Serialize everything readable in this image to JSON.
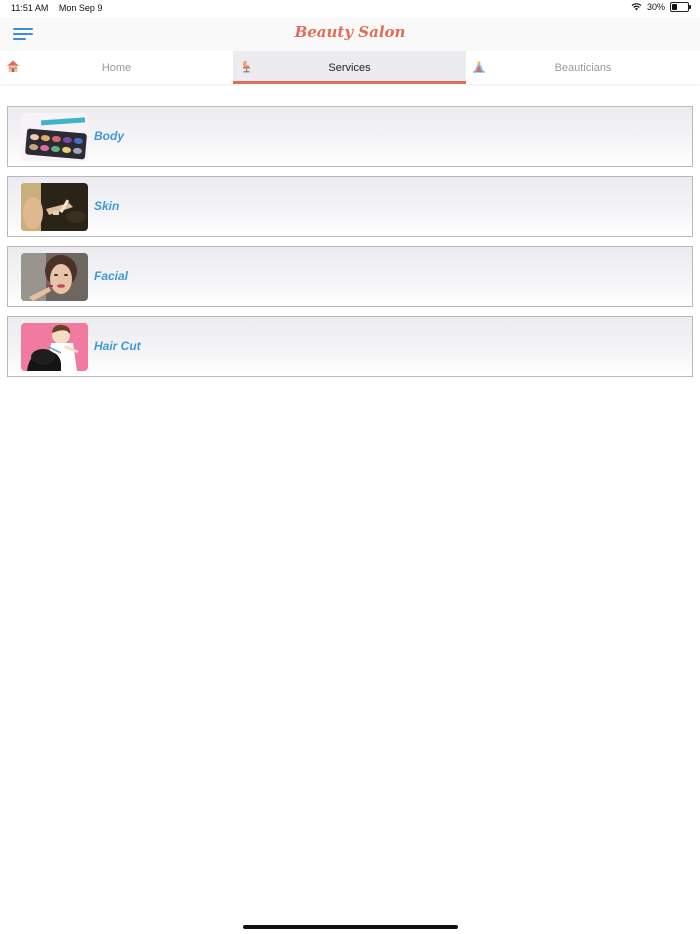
{
  "status_bar": {
    "time": "11:51 AM",
    "date": "Mon Sep 9",
    "battery": "30%",
    "battery_level": 0.3
  },
  "header": {
    "title": "Beauty Salon",
    "menu_icon": "hamburger-menu-icon"
  },
  "tabs": [
    {
      "label": "Home",
      "icon": "house-icon",
      "active": false
    },
    {
      "label": "Services",
      "icon": "salon-chair-icon",
      "active": true
    },
    {
      "label": "Beauticians",
      "icon": "beautician-icon",
      "active": false
    }
  ],
  "services": [
    {
      "label": "Body",
      "thumbnail": "makeup-palette-image"
    },
    {
      "label": "Skin",
      "thumbnail": "makeup-application-image"
    },
    {
      "label": "Facial",
      "thumbnail": "lipstick-face-image"
    },
    {
      "label": "Hair Cut",
      "thumbnail": "hair-cut-illustration"
    }
  ],
  "colors": {
    "accent": "#e06d55",
    "link": "#3d9ad6",
    "menu": "#3a8fd6"
  }
}
